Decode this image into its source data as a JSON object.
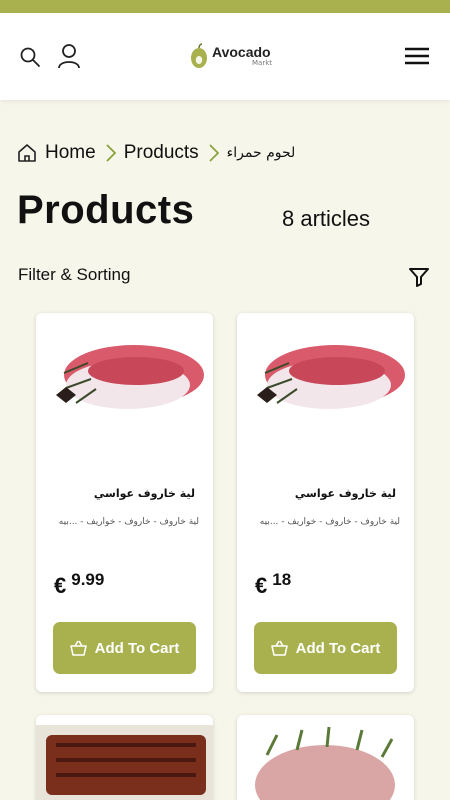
{
  "header": {
    "search_icon": "search-icon",
    "user_icon": "user-icon",
    "logo_name": "Avocado",
    "logo_sub": "Markt",
    "menu_icon": "hamburger-menu-icon"
  },
  "breadcrumb": {
    "home": "Home",
    "products": "Products",
    "current": "لحوم حمراء"
  },
  "page": {
    "title": "Products",
    "count": "8 articles",
    "filter_label": "Filter & Sorting"
  },
  "products": [
    {
      "name": "لية خاروف عواسي",
      "desc": "لية خاروف - خاروف - خواريف - ...بيه",
      "currency": "€",
      "price": "9.99",
      "cart_label": "Add To Cart"
    },
    {
      "name": "لية خاروف عواسي",
      "desc": "لية خاروف - خاروف - خواريف - ...بيه",
      "currency": "€",
      "price": "18",
      "cart_label": "Add To Cart"
    }
  ],
  "colors": {
    "accent": "#a8b14e",
    "background": "#f7f6ea"
  }
}
